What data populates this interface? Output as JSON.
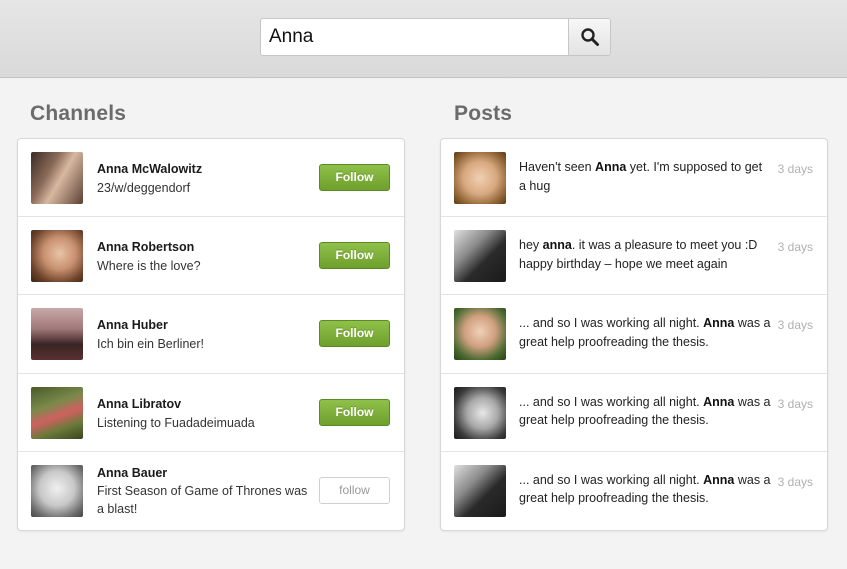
{
  "search": {
    "value": "Anna"
  },
  "channels": {
    "title": "Channels",
    "items": [
      {
        "name": "Anna McWalowitz",
        "desc": "23/w/deggendorf",
        "follow_label": "Follow",
        "state": "primary"
      },
      {
        "name": "Anna Robertson",
        "desc": "Where is the love?",
        "follow_label": "Follow",
        "state": "primary"
      },
      {
        "name": "Anna Huber",
        "desc": "Ich bin ein Berliner!",
        "follow_label": "Follow",
        "state": "primary"
      },
      {
        "name": "Anna Libratov",
        "desc": "Listening to Fuadadeimuada",
        "follow_label": "Follow",
        "state": "primary"
      },
      {
        "name": "Anna Bauer",
        "desc": "First Season of Game of Thrones was a blast!",
        "follow_label": "follow",
        "state": "secondary"
      }
    ]
  },
  "posts": {
    "title": "Posts",
    "items": [
      {
        "before": "Haven't seen ",
        "highlight": "Anna",
        "after": " yet. I'm supposed to get a hug",
        "time": "3 days"
      },
      {
        "before": "hey ",
        "highlight": "anna",
        "after": ". it was a pleasure to meet you :D happy birthday – hope we meet again",
        "time": "3 days"
      },
      {
        "before": "... and so I was working all night. ",
        "highlight": "Anna",
        "after": " was a great help proofreading the thesis.",
        "time": "3 days"
      },
      {
        "before": "... and so I was working all night. ",
        "highlight": "Anna",
        "after": " was a great help proofreading the thesis.",
        "time": "3 days"
      },
      {
        "before": "... and so I was working all night. ",
        "highlight": "Anna",
        "after": " was a great help proofreading the thesis.",
        "time": "3 days"
      }
    ]
  },
  "colors": {
    "follow_green": "#7aab35",
    "muted_text": "#b0b0b0"
  }
}
